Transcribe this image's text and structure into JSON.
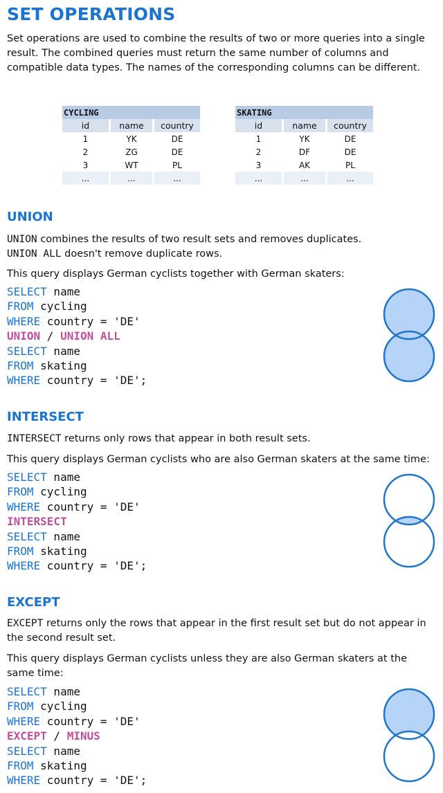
{
  "title": "SET OPERATIONS",
  "intro": "Set operations are used to combine the results of two or more queries into a single result. The combined queries must return the same number of columns and compatible data types. The names of the corresponding columns can be different.",
  "tables": [
    {
      "name": "CYCLING",
      "headers": [
        "id",
        "name",
        "country"
      ],
      "rows": [
        [
          "1",
          "YK",
          "DE"
        ],
        [
          "2",
          "ZG",
          "DE"
        ],
        [
          "3",
          "WT",
          "PL"
        ],
        [
          "...",
          "...",
          "..."
        ]
      ]
    },
    {
      "name": "SKATING",
      "headers": [
        "id",
        "name",
        "country"
      ],
      "rows": [
        [
          "1",
          "YK",
          "DE"
        ],
        [
          "2",
          "DF",
          "DE"
        ],
        [
          "3",
          "AK",
          "PL"
        ],
        [
          "...",
          "...",
          "..."
        ]
      ]
    }
  ],
  "union": {
    "heading": "UNION",
    "desc_kw1": "UNION",
    "desc_text1": " combines the results of two result sets and removes duplicates.",
    "desc_kw2": "UNION ALL",
    "desc_text2": " doesn't remove duplicate rows.",
    "intro": "This query displays German cyclists together with German skaters:",
    "op": "UNION",
    "op_sep": " / ",
    "op2": "UNION ALL"
  },
  "intersect": {
    "heading": "INTERSECT",
    "desc_kw": "INTERSECT",
    "desc_text": " returns only rows that appear in both result sets.",
    "intro": "This query displays German cyclists who are also German skaters at the same time:",
    "op": "INTERSECT"
  },
  "except": {
    "heading": "EXCEPT",
    "desc_kw": "EXCEPT",
    "desc_text": " returns only the rows that appear in the first result set but do not appear in the second result set.",
    "intro": "This query displays German cyclists unless they are also German skaters at the same time:",
    "op": "EXCEPT",
    "op_sep": " / ",
    "op2": "MINUS"
  },
  "query": {
    "select": "SELECT",
    "from": "FROM",
    "where": "WHERE",
    "col": " name",
    "table1": " cycling",
    "table2": " skating",
    "cond1": " country = 'DE'",
    "cond2": " country = 'DE';"
  },
  "colors": {
    "accent": "#1a74d2",
    "operator": "#c0509e",
    "venn_fill": "#b5d4f8",
    "venn_stroke": "#1f75cc",
    "table_header": "#d8e1ee",
    "table_name": "#b8cbe4"
  }
}
